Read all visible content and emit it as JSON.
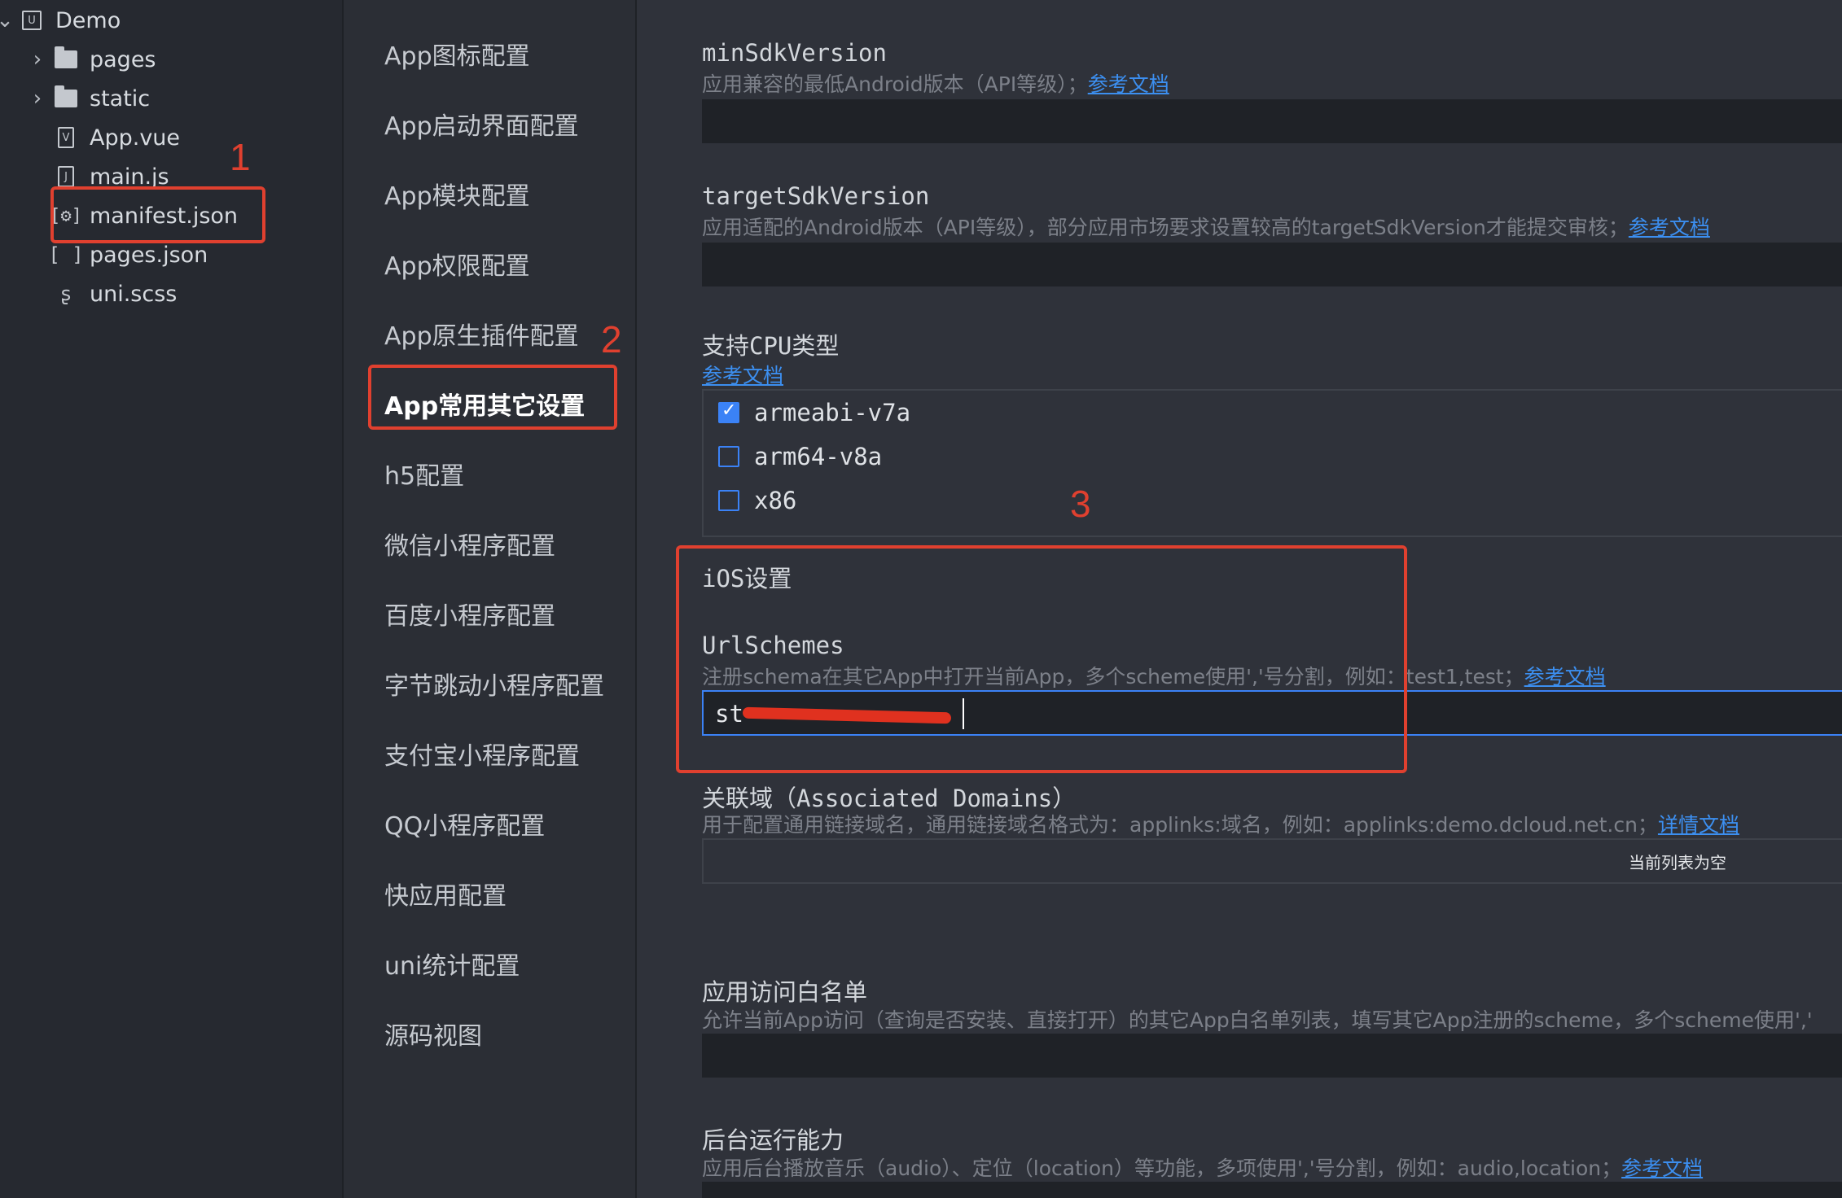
{
  "tree": {
    "root": "Demo",
    "items": [
      {
        "label": "pages"
      },
      {
        "label": "static"
      },
      {
        "label": "App.vue"
      },
      {
        "label": "main.js"
      },
      {
        "label": "manifest.json"
      },
      {
        "label": "pages.json"
      },
      {
        "label": "uni.scss"
      }
    ]
  },
  "nav": {
    "items": [
      "App图标配置",
      "App启动界面配置",
      "App模块配置",
      "App权限配置",
      "App原生插件配置",
      "App常用其它设置",
      "h5配置",
      "微信小程序配置",
      "百度小程序配置",
      "字节跳动小程序配置",
      "支付宝小程序配置",
      "QQ小程序配置",
      "快应用配置",
      "uni统计配置",
      "源码视图"
    ],
    "active_index": 5
  },
  "annotations": {
    "n1": "1",
    "n2": "2",
    "n3": "3"
  },
  "settings": {
    "min_sdk": {
      "title": "minSdkVersion",
      "desc": "应用兼容的最低Android版本（API等级）；",
      "link": "参考文档"
    },
    "target_sdk": {
      "title": "targetSdkVersion",
      "desc": "应用适配的Android版本（API等级），部分应用市场要求设置较高的targetSdkVersion才能提交审核；",
      "link": "参考文档"
    },
    "cpu": {
      "title": "支持CPU类型",
      "link": "参考文档",
      "options": [
        {
          "label": "armeabi-v7a",
          "checked": true
        },
        {
          "label": "arm64-v8a",
          "checked": false
        },
        {
          "label": "x86",
          "checked": false
        }
      ]
    },
    "ios": {
      "title": "iOS设置"
    },
    "url_schemes": {
      "title": "UrlSchemes",
      "desc": "注册schema在其它App中打开当前App，多个scheme使用','号分割，例如：test1,test；",
      "link": "参考文档",
      "value": "st"
    },
    "domains": {
      "title": "关联域（Associated Domains）",
      "desc": "用于配置通用链接域名，通用链接域名格式为：applinks:域名，例如：applinks:demo.dcloud.net.cn；",
      "link": "详情文档",
      "empty": "当前列表为空"
    },
    "whitelist": {
      "title": "应用访问白名单",
      "desc": "允许当前App访问（查询是否安装、直接打开）的其它App白名单列表，填写其它App注册的scheme，多个scheme使用','"
    },
    "background": {
      "title": "后台运行能力",
      "desc": "应用后台播放音乐（audio）、定位（location）等功能，多项使用','号分割，例如：audio,location；",
      "link": "参考文档"
    }
  }
}
